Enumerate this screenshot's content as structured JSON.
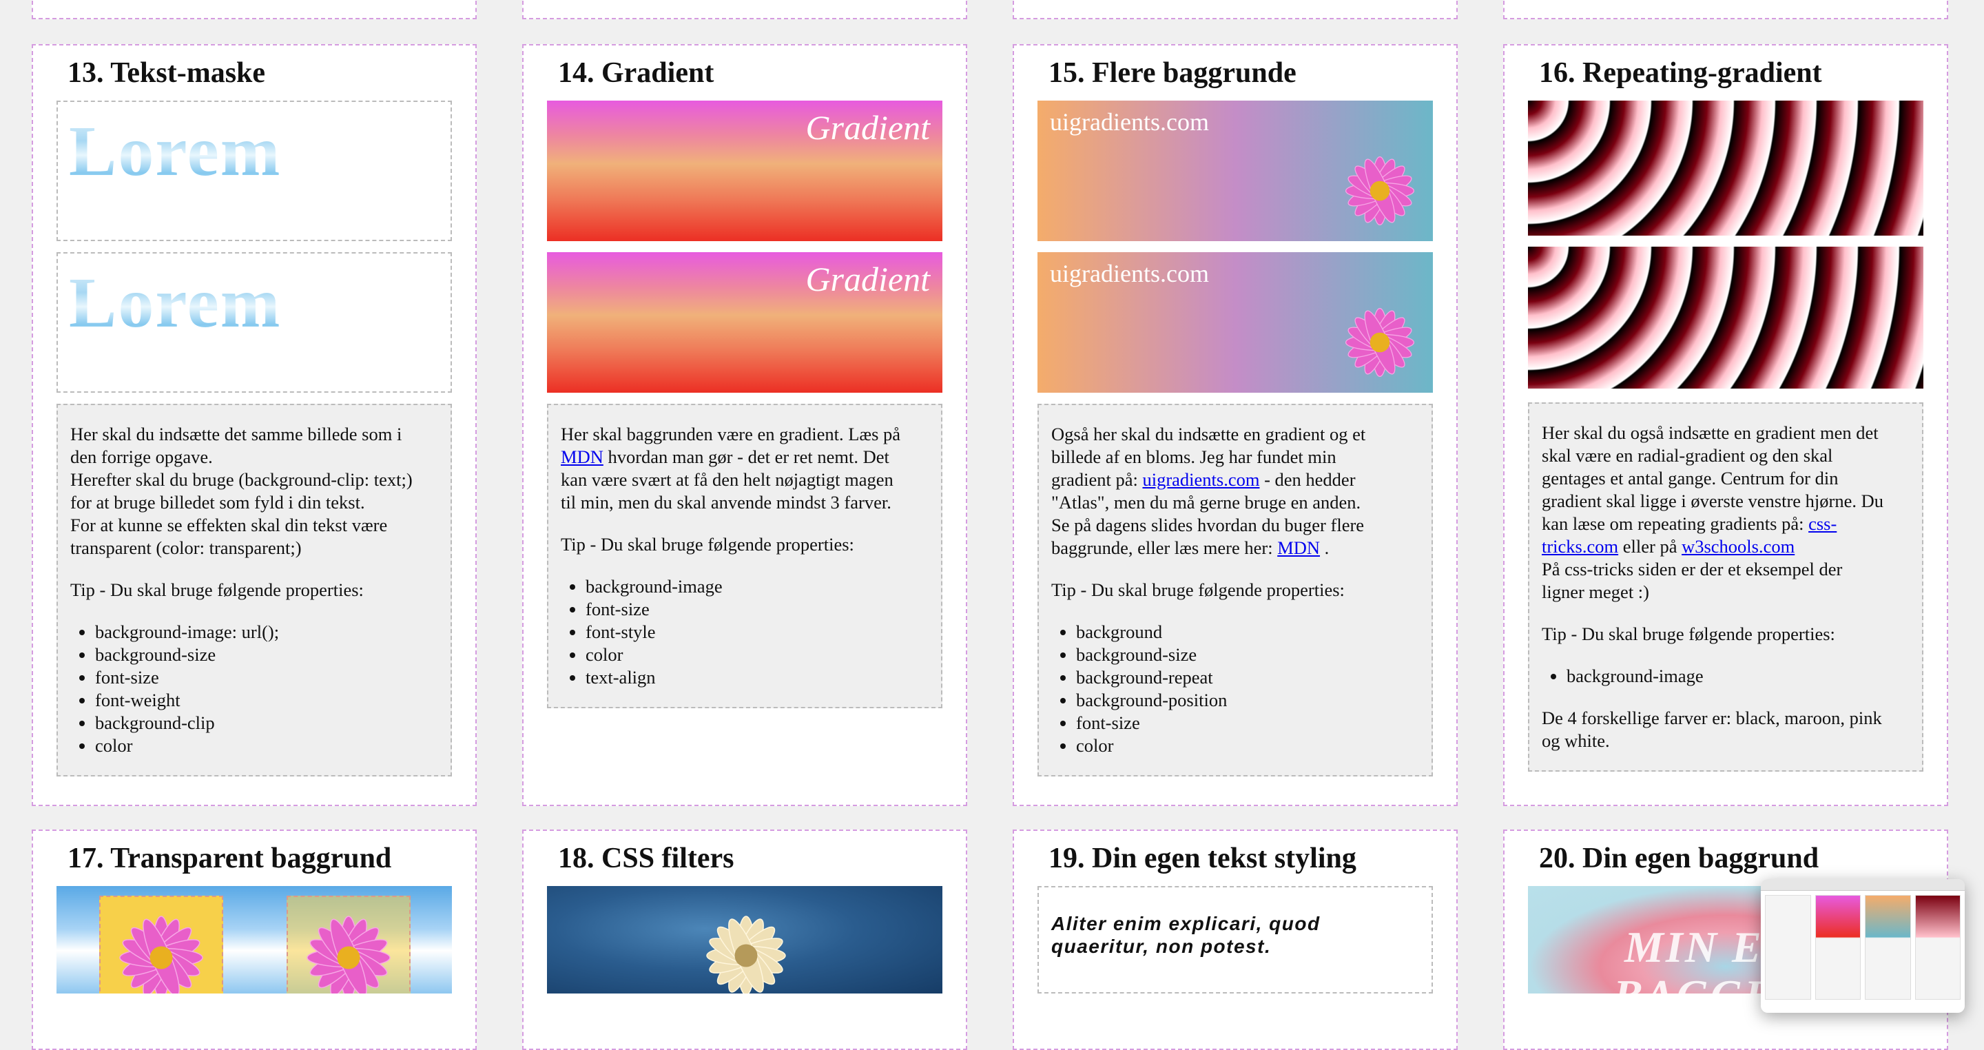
{
  "cards": {
    "c13": {
      "title": "13. Tekst-maske",
      "preview_text_1": "Lorem",
      "preview_text_2": "Lorem",
      "lines": [
        "Her skal du indsætte det samme billede som i",
        "den forrige opgave.",
        "Herefter skal du bruge (background-clip: text;)",
        "for at bruge billedet som fyld i din tekst.",
        "For at kunne se effekten skal din tekst være",
        "transparent (color: transparent;)"
      ],
      "tip": "Tip - Du skal bruge følgende properties:",
      "props": [
        "background-image: url();",
        "background-size",
        "font-size",
        "font-weight",
        "background-clip",
        "color"
      ]
    },
    "c14": {
      "title": "14. Gradient",
      "preview_text_1": "Gradient",
      "preview_text_2": "Gradient",
      "l1": "Her skal baggrunden være en gradient. Læs på",
      "link_mdn": "MDN",
      "l2": " hvordan man gør - det er ret nemt. Det",
      "l3": "kan være svært at få den helt nøjagtigt magen",
      "l4": "til min, men du skal anvende mindst 3 farver.",
      "tip": "Tip - Du skal bruge følgende properties:",
      "props": [
        "background-image",
        "font-size",
        "font-style",
        "color",
        "text-align"
      ]
    },
    "c15": {
      "title": "15. Flere baggrunde",
      "preview_text_1": "uigradients.com",
      "preview_text_2": "uigradients.com",
      "l1": "Også her skal du indsætte en gradient og et",
      "l2": "billede af en bloms. Jeg har fundet min",
      "l3a": "gradient på: ",
      "link_ui": "uigradients.com",
      "l3b": " - den hedder",
      "l4": "\"Atlas\", men du må gerne bruge en anden.",
      "l5": "Se på dagens slides hvordan du buger flere",
      "l6a": "baggrunde, eller læs mere her: ",
      "link_mdn": "MDN",
      "l6b": " .",
      "tip": "Tip - Du skal bruge følgende properties:",
      "props": [
        "background",
        "background-size",
        "background-repeat",
        "background-position",
        "font-size",
        "color"
      ]
    },
    "c16": {
      "title": "16. Repeating-gradient",
      "l1": "Her skal du også indsætte en gradient men det",
      "l2": "skal være en radial-gradient og den skal",
      "l3": "gentages et antal gange. Centrum for din",
      "l4": "gradient skal ligge i øverste venstre hjørne. Du",
      "l5a": "kan læse om repeating gradients på: ",
      "link_css1": "css-",
      "link_css2": "tricks.com",
      "l6b": " eller på ",
      "link_w3": "w3schools.com",
      "l7": "På css-tricks siden er der et eksempel der",
      "l8": "ligner meget :)",
      "tip": "Tip - Du skal bruge følgende properties:",
      "props": [
        "background-image"
      ],
      "end1": "De 4 forskellige farver er: black, maroon, pink",
      "end2": "og white."
    },
    "c17": {
      "title": "17. Transparent baggrund"
    },
    "c18": {
      "title": "18. CSS filters"
    },
    "c19": {
      "title": "19. Din egen tekst styling",
      "sample_1": "Aliter enim explicari, quod",
      "sample_2": "quaeritur, non potest."
    },
    "c20": {
      "title": "20. Din egen baggrund",
      "preview_1": "MIN EG",
      "preview_2": "BAGGR"
    }
  },
  "colors": {
    "card_border": "#d59ce0",
    "link": "#0000ee",
    "page_bg": "#f0f0f0"
  }
}
